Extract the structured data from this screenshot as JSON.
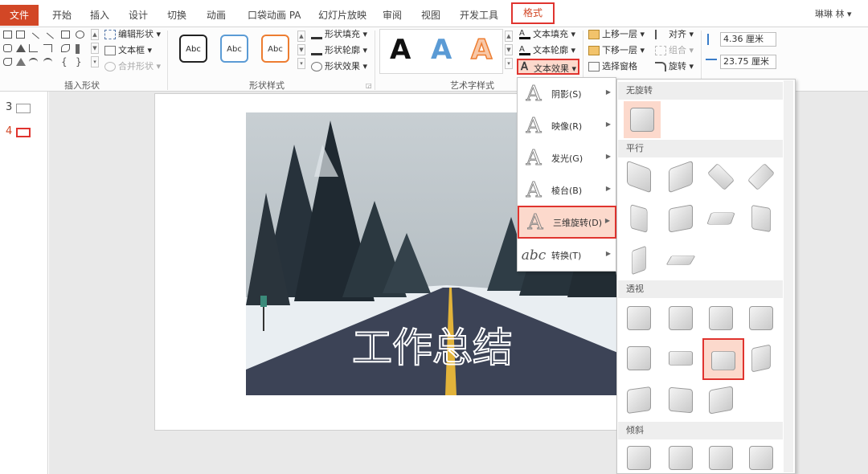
{
  "tabs": {
    "file": "文件",
    "items": [
      "开始",
      "插入",
      "设计",
      "切换",
      "动画",
      "口袋动画 PA",
      "幻灯片放映",
      "审阅",
      "视图",
      "开发工具"
    ],
    "format": "格式"
  },
  "user": "琳琳 林 ▾",
  "ribbon": {
    "insert_shapes": {
      "label": "插入形状",
      "edit_shape": "编辑形状 ▾",
      "text_box": "文本框 ▾",
      "merge_shapes": "合并形状 ▾"
    },
    "shape_styles": {
      "label": "形状样式",
      "abc": [
        "Abc",
        "Abc",
        "Abc"
      ],
      "fill": "形状填充 ▾",
      "outline": "形状轮廓 ▾",
      "effects": "形状效果 ▾"
    },
    "wordart": {
      "label": "艺术字样式",
      "samples": [
        "A",
        "A",
        "A"
      ],
      "text_fill": "文本填充 ▾",
      "text_outline": "文本轮廓 ▾",
      "text_effects": "文本效果 ▾"
    },
    "arrange": {
      "bring_forward": "上移一层 ▾",
      "send_backward": "下移一层 ▾",
      "selection_pane": "选择窗格",
      "align": "对齐 ▾",
      "group": "组合 ▾",
      "rotate": "旋转 ▾"
    },
    "size": {
      "height": "4.36 厘米",
      "width": "23.75 厘米"
    }
  },
  "slides": [
    {
      "num": "3"
    },
    {
      "num": "4"
    }
  ],
  "slide_title": "工作总结",
  "menu": {
    "items": [
      {
        "label": "阴影(S)",
        "glyph": "A"
      },
      {
        "label": "映像(R)",
        "glyph": "A"
      },
      {
        "label": "发光(G)",
        "glyph": "A"
      },
      {
        "label": "棱台(B)",
        "glyph": "A"
      },
      {
        "label": "三维旋转(D)",
        "glyph": "A"
      },
      {
        "label": "转换(T)",
        "glyph": "abc"
      }
    ]
  },
  "rotation_panel": {
    "sections": [
      "无旋转",
      "平行",
      "透视",
      "倾斜"
    ]
  },
  "colors": {
    "accent": "#d24726",
    "highlight_border": "#e0342f",
    "highlight_bg": "#fcd9cc"
  }
}
